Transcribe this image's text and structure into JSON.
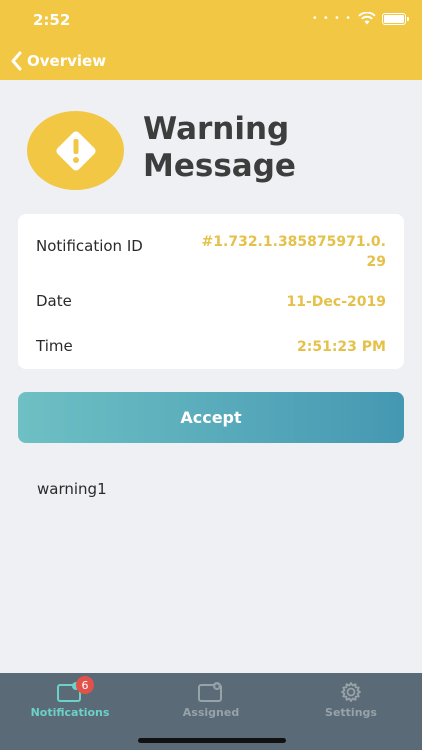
{
  "status_bar": {
    "time": "2:52"
  },
  "header": {
    "back_label": "Overview",
    "background_color": "#f2c744"
  },
  "hero": {
    "title": "Warning\nMessage",
    "icon": "warning-diamond-icon"
  },
  "details": {
    "rows": [
      {
        "label": "Notification ID",
        "value": "#1.732.1.385875971.0.\n29"
      },
      {
        "label": "Date",
        "value": "11-Dec-2019"
      },
      {
        "label": "Time",
        "value": "2:51:23 PM"
      }
    ],
    "value_color": "#e5c14a"
  },
  "actions": {
    "accept_label": "Accept"
  },
  "message": {
    "body": "warning1"
  },
  "tab_bar": {
    "tabs": [
      {
        "label": "Notifications",
        "icon": "notifications-icon",
        "badge": "6",
        "active": true
      },
      {
        "label": "Assigned",
        "icon": "assigned-icon",
        "active": false
      },
      {
        "label": "Settings",
        "icon": "gear-icon",
        "active": false
      }
    ],
    "active_color": "#6cd1c9",
    "background_color": "#5a6a76"
  }
}
